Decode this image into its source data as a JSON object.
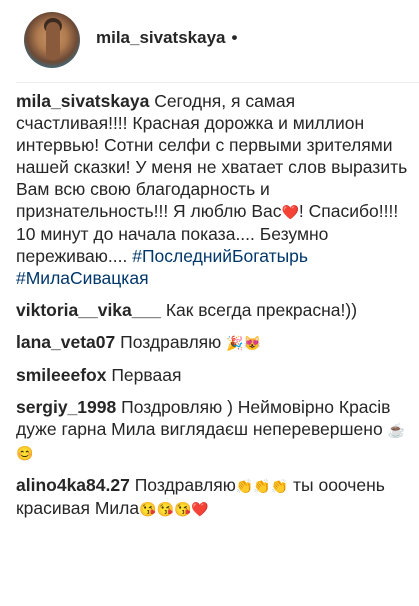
{
  "post": {
    "username": "mila_sivatskaya",
    "dot": "•"
  },
  "caption": {
    "username": "mila_sivatskaya",
    "text": "Сегодня, я самая счастливая!!!! Красная дорожка и миллион интервью! Сотни селфи с первыми зрителями нашей сказки! У меня не хватает слов выразить Вам всю свою благодарность и признательность!!! Я люблю Вас",
    "emoji_heart": "❤️",
    "text2": "! Спасибо!!!! 10 минут до начала показа.... Безумно переживаю....",
    "hashtag1": "#ПоследнийБогатырь",
    "hashtag2": "#МилаСивацкая"
  },
  "comments": [
    {
      "username": "viktoria__vika___",
      "text": "Как всегда прекрасна!))",
      "emoji": ""
    },
    {
      "username": "lana_veta07",
      "text": "Поздравляю",
      "emoji": "🎉😻"
    },
    {
      "username": "smileeefox",
      "text": "Перваая",
      "emoji": ""
    },
    {
      "username": "sergiy_1998",
      "text": "Поздровляю ) Неймовірно Красів дуже гарна Мила виглядаєш неперевершено",
      "emoji": "☕😊"
    },
    {
      "username": "alino4ka84.27",
      "text": "Поздравляю",
      "emoji": "👏👏👏",
      "text2": "ты ооочень красивая Мила",
      "emoji2": "😘😘😘❤️"
    }
  ]
}
